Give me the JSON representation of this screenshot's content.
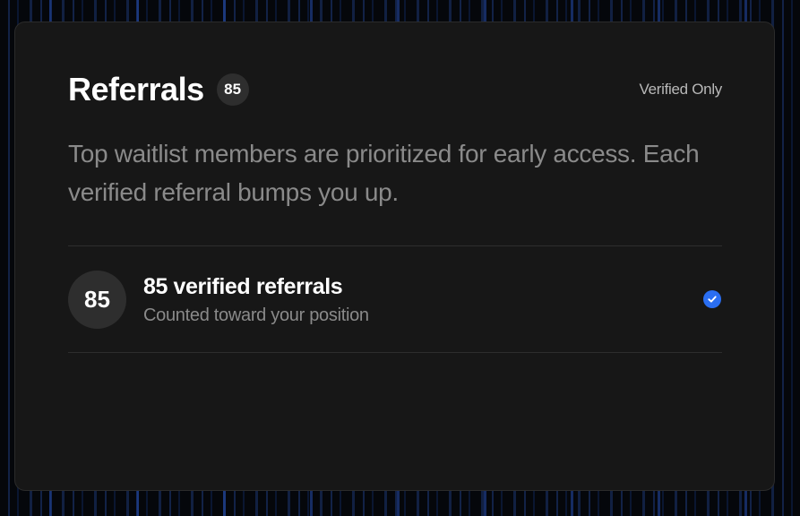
{
  "card": {
    "title": "Referrals",
    "count_badge": "85",
    "filter_label": "Verified Only",
    "description": "Top waitlist members are prioritized for early access. Each verified referral bumps you up."
  },
  "referral_row": {
    "avatar_text": "85",
    "title": "85 verified referrals",
    "subtitle": "Counted toward your position",
    "status_icon": "check-circle-icon"
  },
  "colors": {
    "card_bg": "#171717",
    "accent_blue": "#2a6ef2",
    "text_primary": "#ffffff",
    "text_muted": "#8a8a8a"
  }
}
